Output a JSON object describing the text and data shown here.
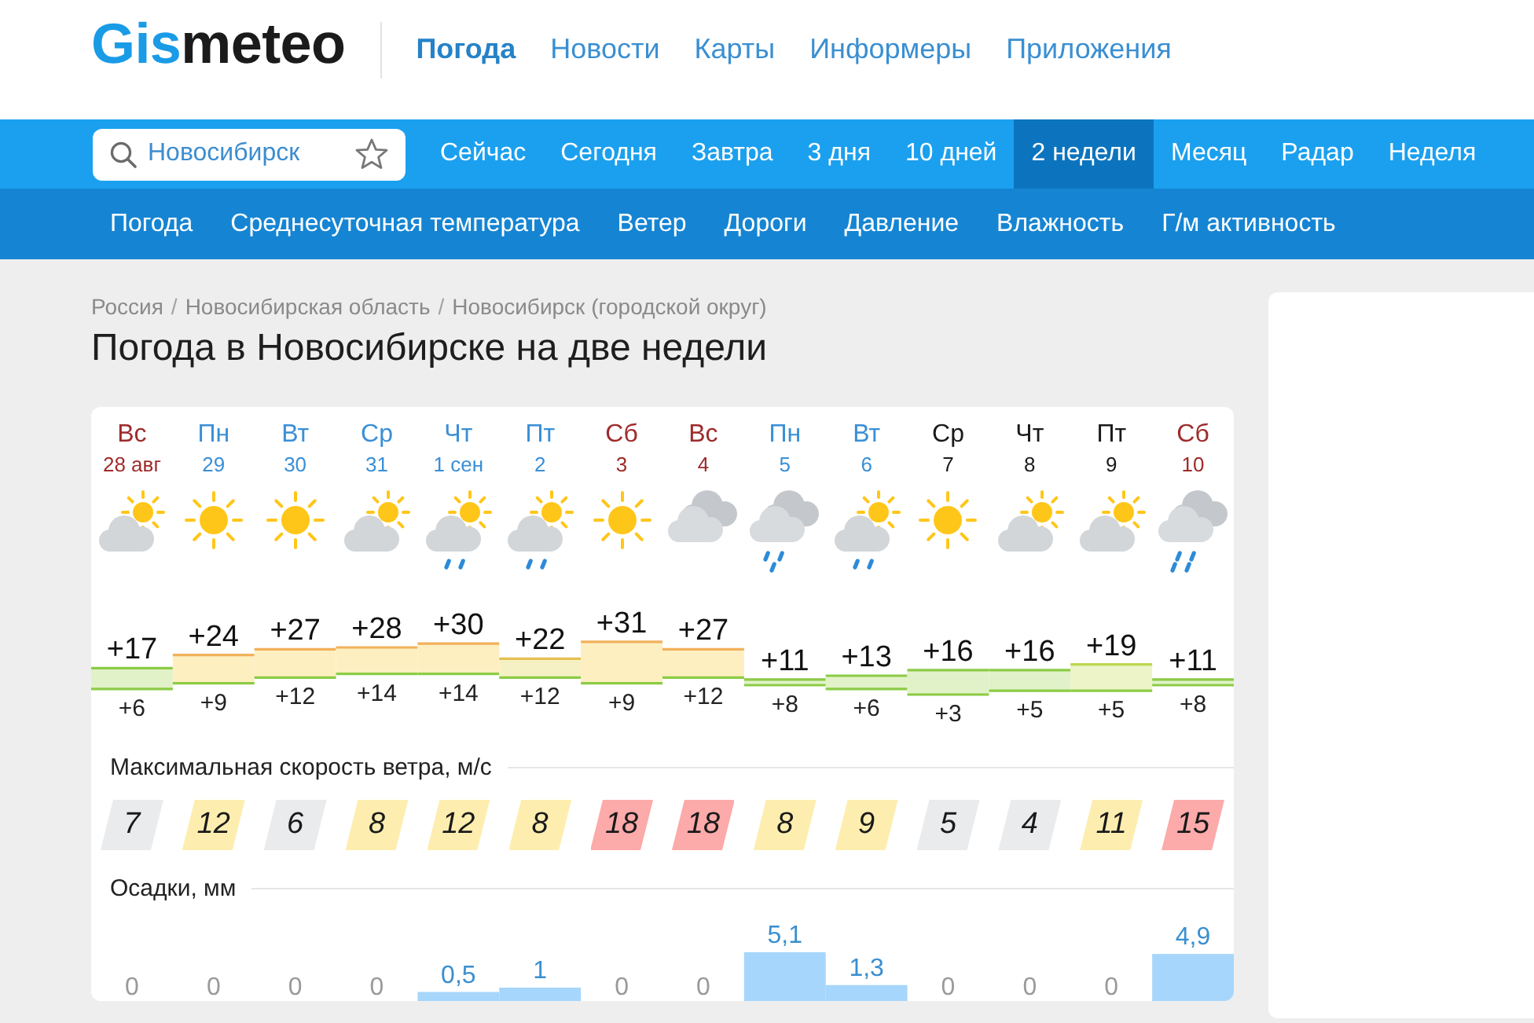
{
  "header": {
    "logo": {
      "accent": "Gis",
      "rest": "meteo"
    },
    "nav": [
      {
        "label": "Погода",
        "selected": true
      },
      {
        "label": "Новости",
        "selected": false
      },
      {
        "label": "Карты",
        "selected": false
      },
      {
        "label": "Информеры",
        "selected": false
      },
      {
        "label": "Приложения",
        "selected": false
      }
    ]
  },
  "nav_bar": {
    "search": {
      "value": "Новосибирск"
    },
    "tabs": [
      {
        "label": "Сейчас",
        "selected": false
      },
      {
        "label": "Сегодня",
        "selected": false
      },
      {
        "label": "Завтра",
        "selected": false
      },
      {
        "label": "3 дня",
        "selected": false
      },
      {
        "label": "10 дней",
        "selected": false
      },
      {
        "label": "2 недели",
        "selected": true
      },
      {
        "label": "Месяц",
        "selected": false
      },
      {
        "label": "Радар",
        "selected": false
      },
      {
        "label": "Неделя",
        "selected": false
      }
    ]
  },
  "subnav": {
    "items": [
      {
        "label": "Погода",
        "selected": false
      },
      {
        "label": "Среднесуточная температура",
        "selected": false
      },
      {
        "label": "Ветер",
        "selected": false
      },
      {
        "label": "Дороги",
        "selected": false
      },
      {
        "label": "Давление",
        "selected": false
      },
      {
        "label": "Влажность",
        "selected": false
      },
      {
        "label": "Г/м активность",
        "selected": false
      }
    ]
  },
  "breadcrumbs": [
    {
      "label": "Россия",
      "separator": "/"
    },
    {
      "label": "Новосибирская область",
      "separator": "/"
    },
    {
      "label": "Новосибирск (городской округ)"
    }
  ],
  "title": "Погода в Новосибирске на две недели",
  "forecast": {
    "days": [
      {
        "weekday": "Вс",
        "date": "28 авг",
        "color": "#9e2b2b",
        "kind": "partlycloudy"
      },
      {
        "weekday": "Пн",
        "date": "29",
        "color": "#3a8fd6",
        "kind": "sunny"
      },
      {
        "weekday": "Вт",
        "date": "30",
        "color": "#3a8fd6",
        "kind": "sunny"
      },
      {
        "weekday": "Ср",
        "date": "31",
        "color": "#3a8fd6",
        "kind": "partlycloudy"
      },
      {
        "weekday": "Чт",
        "date": "1 сен",
        "color": "#3a8fd6",
        "kind": "showers"
      },
      {
        "weekday": "Пт",
        "date": "2",
        "color": "#3a8fd6",
        "kind": "showers"
      },
      {
        "weekday": "Сб",
        "date": "3",
        "color": "#9e2b2b",
        "kind": "sunny"
      },
      {
        "weekday": "Вс",
        "date": "4",
        "color": "#9e2b2b",
        "kind": "overcast"
      },
      {
        "weekday": "Пн",
        "date": "5",
        "color": "#3a8fd6",
        "kind": "rain"
      },
      {
        "weekday": "Вт",
        "date": "6",
        "color": "#3a8fd6",
        "kind": "showers"
      },
      {
        "weekday": "Ср",
        "date": "7",
        "color": "#1a1a1a",
        "kind": "sunny"
      },
      {
        "weekday": "Чт",
        "date": "8",
        "color": "#1a1a1a",
        "kind": "partlycloudy"
      },
      {
        "weekday": "Пт",
        "date": "9",
        "color": "#1a1a1a",
        "kind": "partlycloudy"
      },
      {
        "weekday": "Сб",
        "date": "10",
        "color": "#9e2b2b",
        "kind": "heavyrain"
      }
    ],
    "temperature": [
      {
        "max": "+17",
        "min": "+6"
      },
      {
        "max": "+24",
        "min": "+9"
      },
      {
        "max": "+27",
        "min": "+12"
      },
      {
        "max": "+28",
        "min": "+14"
      },
      {
        "max": "+30",
        "min": "+14"
      },
      {
        "max": "+22",
        "min": "+12"
      },
      {
        "max": "+31",
        "min": "+9"
      },
      {
        "max": "+27",
        "min": "+12"
      },
      {
        "max": "+11",
        "min": "+8"
      },
      {
        "max": "+13",
        "min": "+6"
      },
      {
        "max": "+16",
        "min": "+3"
      },
      {
        "max": "+16",
        "min": "+5"
      },
      {
        "max": "+19",
        "min": "+5"
      },
      {
        "max": "+11",
        "min": "+8"
      }
    ],
    "wind": {
      "title": "Максимальная скорость ветра, м/с",
      "values": [
        {
          "value": "7",
          "color": "#e9ebed"
        },
        {
          "value": "12",
          "color": "#fdeeb0"
        },
        {
          "value": "6",
          "color": "#e9ebed"
        },
        {
          "value": "8",
          "color": "#fdeeb0"
        },
        {
          "value": "12",
          "color": "#fdeeb0"
        },
        {
          "value": "8",
          "color": "#fdeeb0"
        },
        {
          "value": "18",
          "color": "#fdaaaa"
        },
        {
          "value": "18",
          "color": "#fdaaaa"
        },
        {
          "value": "8",
          "color": "#fdeeb0"
        },
        {
          "value": "9",
          "color": "#fdeeb0"
        },
        {
          "value": "5",
          "color": "#e9ebed"
        },
        {
          "value": "4",
          "color": "#e9ebed"
        },
        {
          "value": "11",
          "color": "#fdeeb0"
        },
        {
          "value": "15",
          "color": "#fdaaaa"
        }
      ]
    },
    "precipitation": {
      "title": "Осадки, мм",
      "amounts": [
        "0",
        "0",
        "0",
        "0",
        "0,5",
        "1",
        "0",
        "0",
        "5,1",
        "1,3",
        "0",
        "0",
        "0",
        "4,9"
      ]
    }
  }
}
